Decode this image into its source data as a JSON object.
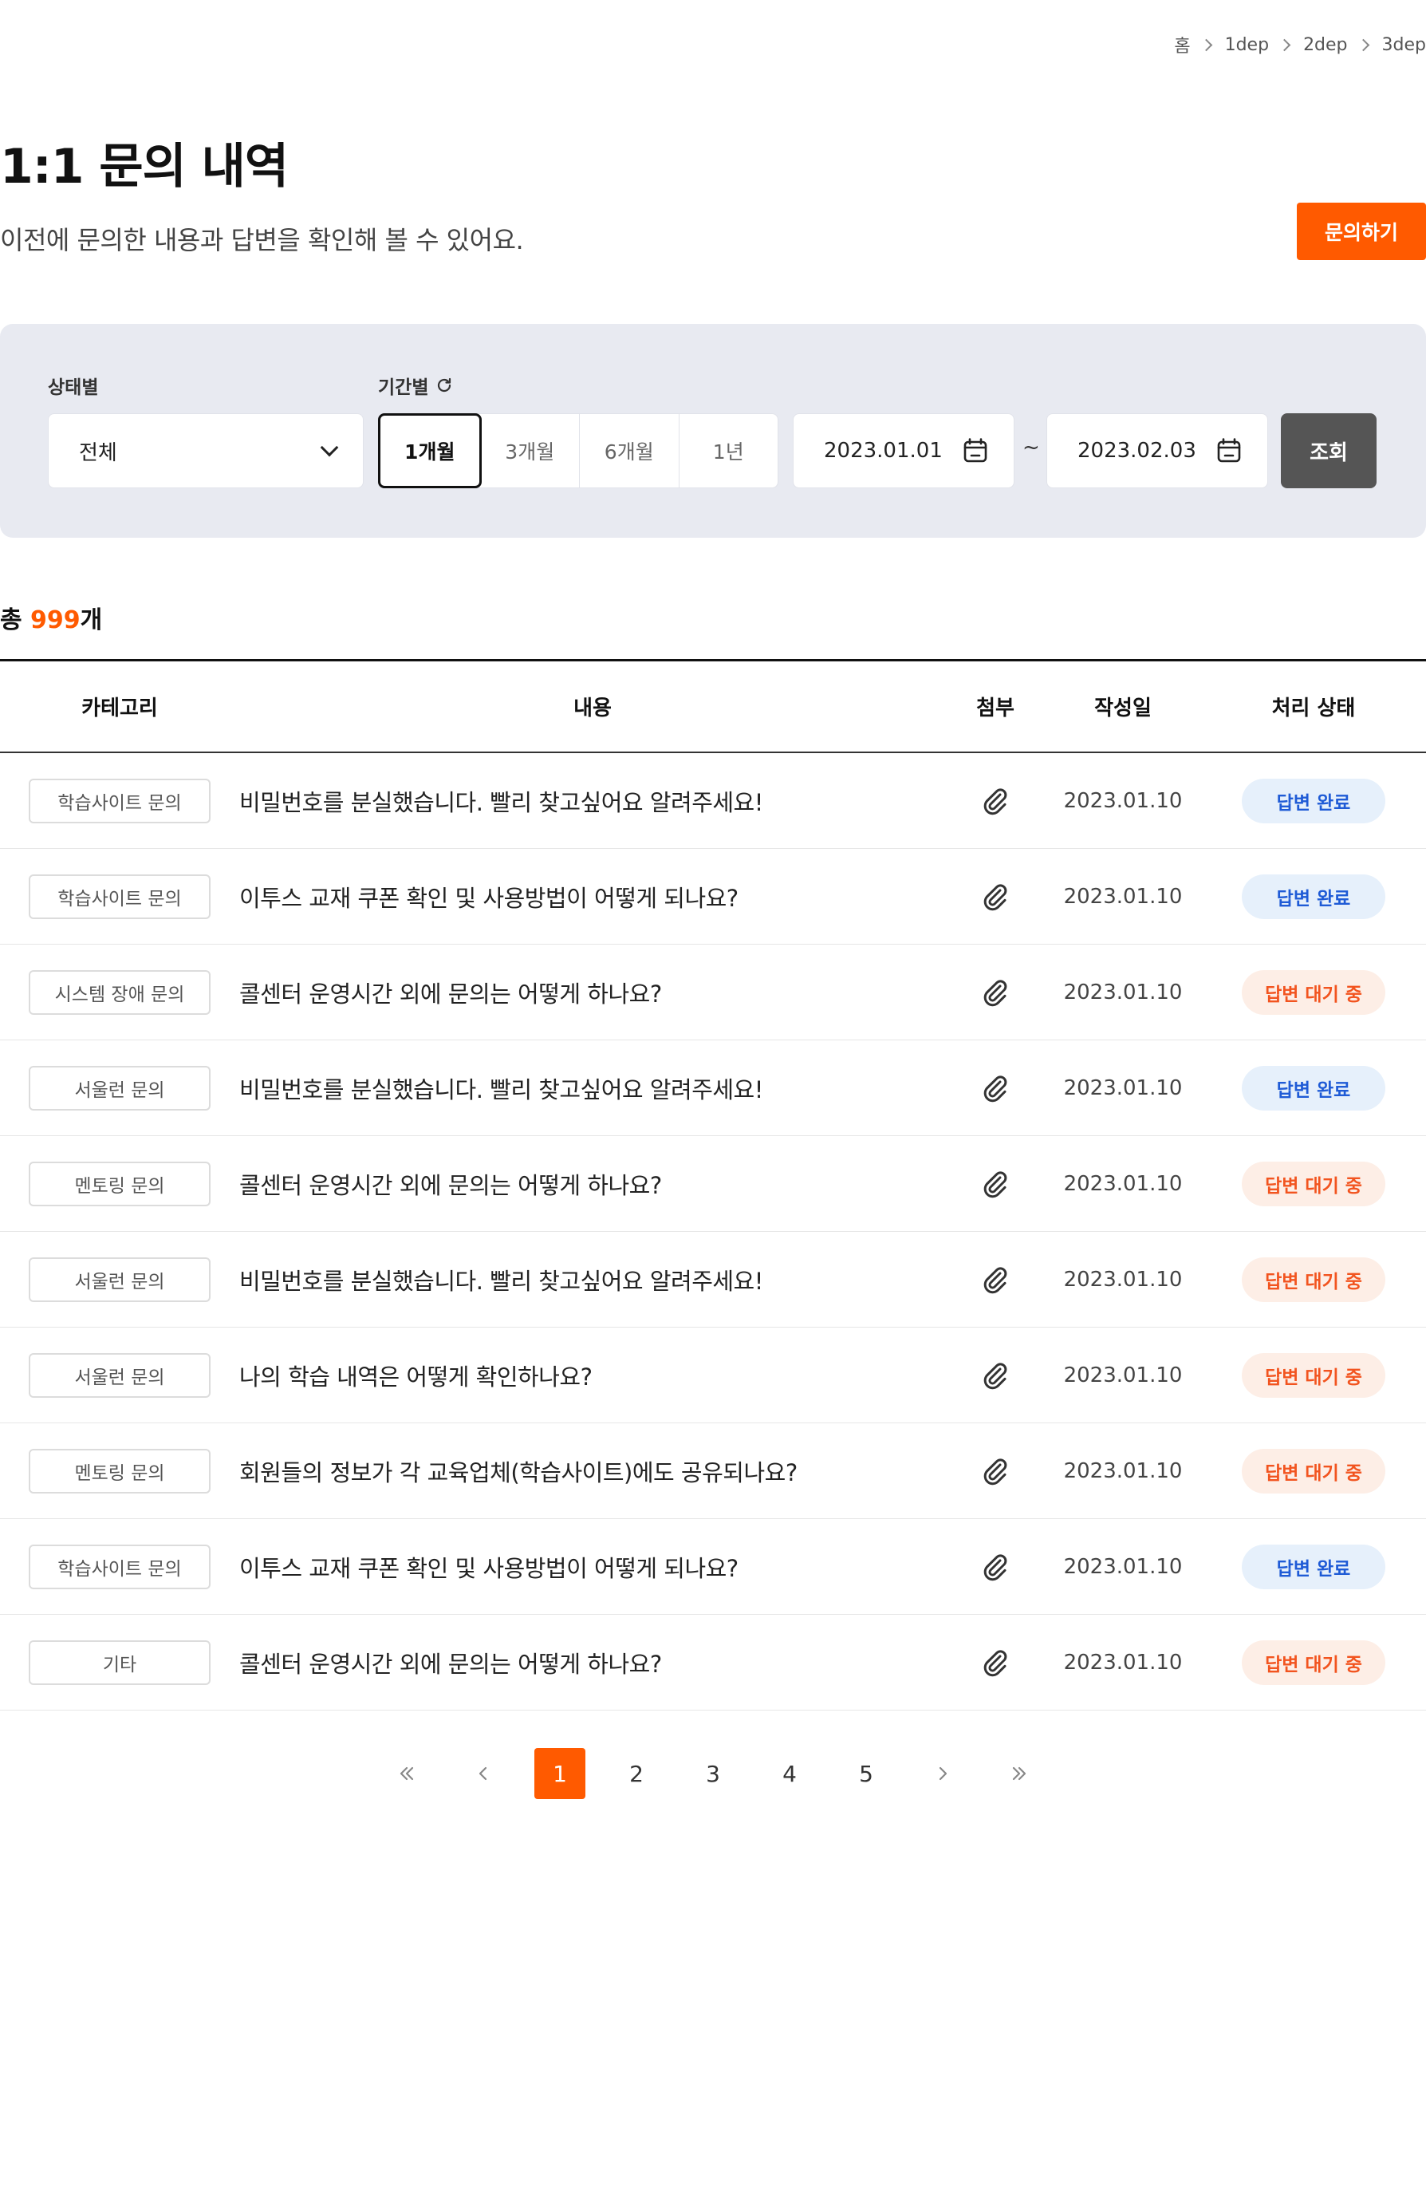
{
  "breadcrumb": [
    "홈",
    "1dep",
    "2dep",
    "3dep"
  ],
  "page": {
    "title": "1:1 문의 내역",
    "description": "이전에 문의한 내용과 답변을 확인해 볼 수 있어요.",
    "inquire_button": "문의하기"
  },
  "filter": {
    "status_label": "상태별",
    "status_value": "전체",
    "period_label": "기간별",
    "periods": [
      "1개월",
      "3개월",
      "6개월",
      "1년"
    ],
    "active_period": "1개월",
    "date_from": "2023.01.01",
    "date_separator": "~",
    "date_to": "2023.02.03",
    "search_button": "조회"
  },
  "total": {
    "prefix": "총 ",
    "count": "999",
    "suffix": "개"
  },
  "table": {
    "headers": {
      "category": "카테고리",
      "content": "내용",
      "attachment": "첨부",
      "date": "작성일",
      "status": "처리 상태"
    },
    "rows": [
      {
        "category": "학습사이트 문의",
        "content": "비밀번호를 분실했습니다. 빨리 찾고싶어요 알려주세요!",
        "date": "2023.01.10",
        "status": "답변 완료",
        "state": "done"
      },
      {
        "category": "학습사이트 문의",
        "content": "이투스 교재 쿠폰 확인 및 사용방법이 어떻게 되나요?",
        "date": "2023.01.10",
        "status": "답변 완료",
        "state": "done"
      },
      {
        "category": "시스템 장애 문의",
        "content": "콜센터 운영시간 외에 문의는 어떻게 하나요?",
        "date": "2023.01.10",
        "status": "답변 대기 중",
        "state": "wait"
      },
      {
        "category": "서울런 문의",
        "content": "비밀번호를 분실했습니다. 빨리 찾고싶어요 알려주세요!",
        "date": "2023.01.10",
        "status": "답변 완료",
        "state": "done"
      },
      {
        "category": "멘토링 문의",
        "content": "콜센터 운영시간 외에 문의는 어떻게 하나요?",
        "date": "2023.01.10",
        "status": "답변 대기 중",
        "state": "wait"
      },
      {
        "category": "서울런 문의",
        "content": "비밀번호를 분실했습니다. 빨리 찾고싶어요 알려주세요!",
        "date": "2023.01.10",
        "status": "답변 대기 중",
        "state": "wait"
      },
      {
        "category": "서울런 문의",
        "content": "나의 학습 내역은 어떻게 확인하나요?",
        "date": "2023.01.10",
        "status": "답변 대기 중",
        "state": "wait"
      },
      {
        "category": "멘토링 문의",
        "content": "회원들의 정보가 각 교육업체(학습사이트)에도 공유되나요?",
        "date": "2023.01.10",
        "status": "답변 대기 중",
        "state": "wait"
      },
      {
        "category": "학습사이트 문의",
        "content": "이투스 교재 쿠폰 확인 및 사용방법이 어떻게 되나요?",
        "date": "2023.01.10",
        "status": "답변 완료",
        "state": "done"
      },
      {
        "category": "기타",
        "content": "콜센터 운영시간 외에 문의는 어떻게 하나요?",
        "date": "2023.01.10",
        "status": "답변 대기 중",
        "state": "wait"
      }
    ]
  },
  "pagination": {
    "pages": [
      "1",
      "2",
      "3",
      "4",
      "5"
    ],
    "current": "1"
  },
  "colors": {
    "accent": "#ff5a00",
    "panel_bg": "#e8eaf1",
    "search_button_bg": "#555555",
    "badge_done_bg": "#e6f0fb",
    "badge_done_text": "#1f5bd6",
    "badge_wait_bg": "#fdeee6",
    "badge_wait_text": "#f2541f"
  },
  "icons": {
    "breadcrumb_separator": "chevron-right-icon",
    "period_reset": "refresh-icon",
    "select_toggle": "chevron-down-icon",
    "date_picker": "calendar-icon",
    "attachment": "paperclip-icon",
    "first_page": "double-chevron-left-icon",
    "prev_page": "chevron-left-icon",
    "next_page": "chevron-right-icon",
    "last_page": "double-chevron-right-icon"
  }
}
